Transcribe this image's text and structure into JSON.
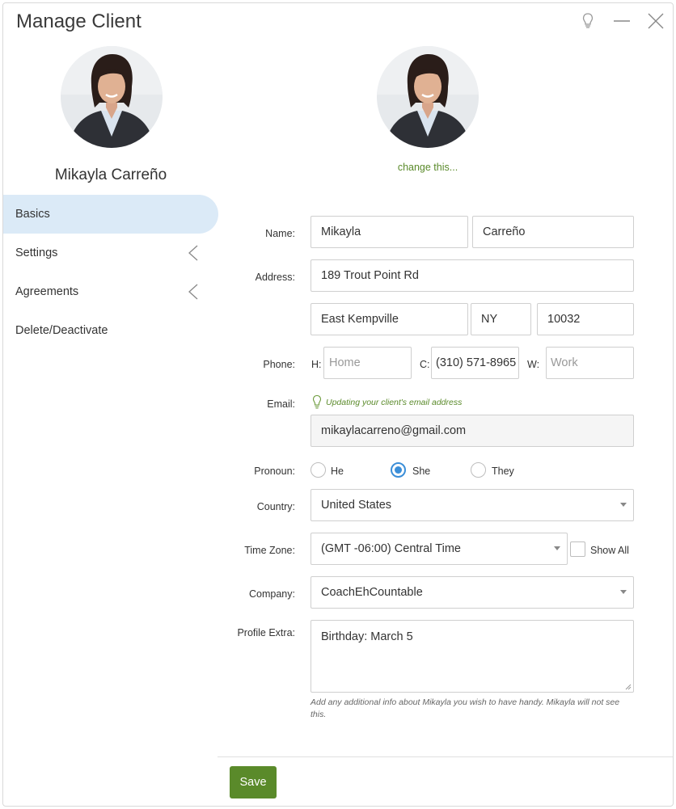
{
  "window": {
    "title": "Manage Client",
    "header_icons": [
      "lightbulb-icon",
      "minimize-icon",
      "close-icon"
    ]
  },
  "sidebar": {
    "client_name": "Mikayla Carreño",
    "items": [
      {
        "label": "Basics",
        "active": true,
        "has_chevron": false
      },
      {
        "label": "Settings",
        "active": false,
        "has_chevron": true
      },
      {
        "label": "Agreements",
        "active": false,
        "has_chevron": true
      },
      {
        "label": "Delete/Deactivate",
        "active": false,
        "has_chevron": false
      }
    ]
  },
  "profile": {
    "change_photo_label": "change this..."
  },
  "form": {
    "name": {
      "label": "Name:",
      "first": "Mikayla",
      "last": "Carreño"
    },
    "address": {
      "label": "Address:",
      "street": "189 Trout Point Rd",
      "city": "East Kempville",
      "state": "NY",
      "zip": "10032"
    },
    "phone": {
      "label": "Phone:",
      "home_prefix": "H:",
      "home_placeholder": "Home",
      "home_value": "",
      "cell_prefix": "C:",
      "cell_value": "(310) 571-8965",
      "work_prefix": "W:",
      "work_placeholder": "Work",
      "work_value": ""
    },
    "email": {
      "label": "Email:",
      "hint": "Updating your client's email address",
      "value": "mikaylacarreno@gmail.com"
    },
    "pronoun": {
      "label": "Pronoun:",
      "options": [
        "He",
        "She",
        "They"
      ],
      "selected": "She"
    },
    "country": {
      "label": "Country:",
      "value": "United States"
    },
    "time_zone": {
      "label": "Time Zone:",
      "value": "(GMT -06:00) Central Time",
      "show_all_label": "Show All",
      "show_all_checked": false
    },
    "company": {
      "label": "Company:",
      "value": "CoachEhCountable"
    },
    "profile_extra": {
      "label": "Profile Extra:",
      "value": "Birthday: March 5",
      "help": "Add any additional info about Mikayla you wish to have handy. Mikayla will not see this."
    }
  },
  "footer": {
    "save_label": "Save"
  },
  "colors": {
    "accent_green": "#5a8a2a",
    "active_nav_bg": "#dbeaf7",
    "radio_blue": "#3b8ed8"
  }
}
